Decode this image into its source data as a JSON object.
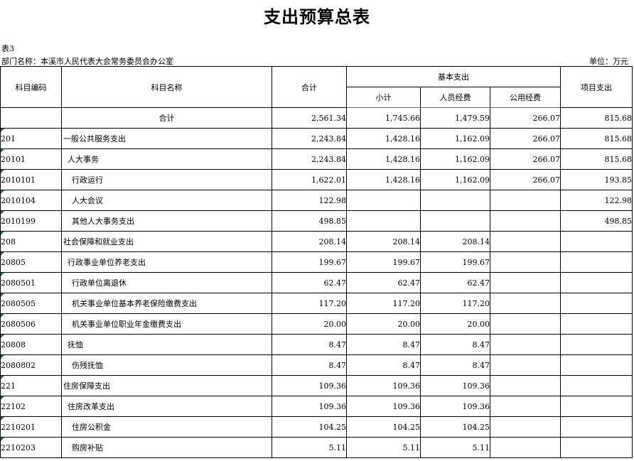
{
  "title": "支出预算总表",
  "table_no": "表3",
  "department": "部门名称：本溪市人民代表大会常务委员会办公室",
  "unit": "单位：万元",
  "headers": {
    "code": "科目编码",
    "name": "科目名称",
    "total": "合计",
    "basic": "基本支出",
    "subtotal": "小计",
    "personnel": "人员经费",
    "public": "公用经费",
    "project": "项目支出"
  },
  "rows": [
    {
      "code": "",
      "name": "合计",
      "level": "total",
      "total": "2,561.34",
      "subtotal": "1,745.66",
      "personnel": "1,479.59",
      "public": "266.07",
      "project": "815.68"
    },
    {
      "code": "201",
      "name": "一般公共服务支出",
      "level": "0",
      "total": "2,243.84",
      "subtotal": "1,428.16",
      "personnel": "1,162.09",
      "public": "266.07",
      "project": "815.68"
    },
    {
      "code": "20101",
      "name": "人大事务",
      "level": "1",
      "total": "2,243.84",
      "subtotal": "1,428.16",
      "personnel": "1,162.09",
      "public": "266.07",
      "project": "815.68"
    },
    {
      "code": "2010101",
      "name": "行政运行",
      "level": "2",
      "total": "1,622.01",
      "subtotal": "1,428.16",
      "personnel": "1,162.09",
      "public": "266.07",
      "project": "193.85"
    },
    {
      "code": "2010104",
      "name": "人大会议",
      "level": "2",
      "total": "122.98",
      "subtotal": "",
      "personnel": "",
      "public": "",
      "project": "122.98"
    },
    {
      "code": "2010199",
      "name": "其他人大事务支出",
      "level": "2",
      "total": "498.85",
      "subtotal": "",
      "personnel": "",
      "public": "",
      "project": "498.85"
    },
    {
      "code": "208",
      "name": "社会保障和就业支出",
      "level": "0",
      "total": "208.14",
      "subtotal": "208.14",
      "personnel": "208.14",
      "public": "",
      "project": ""
    },
    {
      "code": "20805",
      "name": "行政事业单位养老支出",
      "level": "1",
      "total": "199.67",
      "subtotal": "199.67",
      "personnel": "199.67",
      "public": "",
      "project": ""
    },
    {
      "code": "2080501",
      "name": "行政单位离退休",
      "level": "2",
      "total": "62.47",
      "subtotal": "62.47",
      "personnel": "62.47",
      "public": "",
      "project": ""
    },
    {
      "code": "2080505",
      "name": "机关事业单位基本养老保险缴费支出",
      "level": "2",
      "total": "117.20",
      "subtotal": "117.20",
      "personnel": "117.20",
      "public": "",
      "project": ""
    },
    {
      "code": "2080506",
      "name": "机关事业单位职业年金缴费支出",
      "level": "2",
      "total": "20.00",
      "subtotal": "20.00",
      "personnel": "20.00",
      "public": "",
      "project": ""
    },
    {
      "code": "20808",
      "name": "抚恤",
      "level": "1",
      "total": "8.47",
      "subtotal": "8.47",
      "personnel": "8.47",
      "public": "",
      "project": ""
    },
    {
      "code": "2080802",
      "name": "伤残抚恤",
      "level": "2",
      "total": "8.47",
      "subtotal": "8.47",
      "personnel": "8.47",
      "public": "",
      "project": ""
    },
    {
      "code": "221",
      "name": "住房保障支出",
      "level": "0",
      "total": "109.36",
      "subtotal": "109.36",
      "personnel": "109.36",
      "public": "",
      "project": ""
    },
    {
      "code": "22102",
      "name": "住房改革支出",
      "level": "1",
      "total": "109.36",
      "subtotal": "109.36",
      "personnel": "109.36",
      "public": "",
      "project": ""
    },
    {
      "code": "2210201",
      "name": "住房公积金",
      "level": "2",
      "total": "104.25",
      "subtotal": "104.25",
      "personnel": "104.25",
      "public": "",
      "project": ""
    },
    {
      "code": "2210203",
      "name": "购房补贴",
      "level": "2",
      "total": "5.11",
      "subtotal": "5.11",
      "personnel": "5.11",
      "public": "",
      "project": ""
    }
  ]
}
